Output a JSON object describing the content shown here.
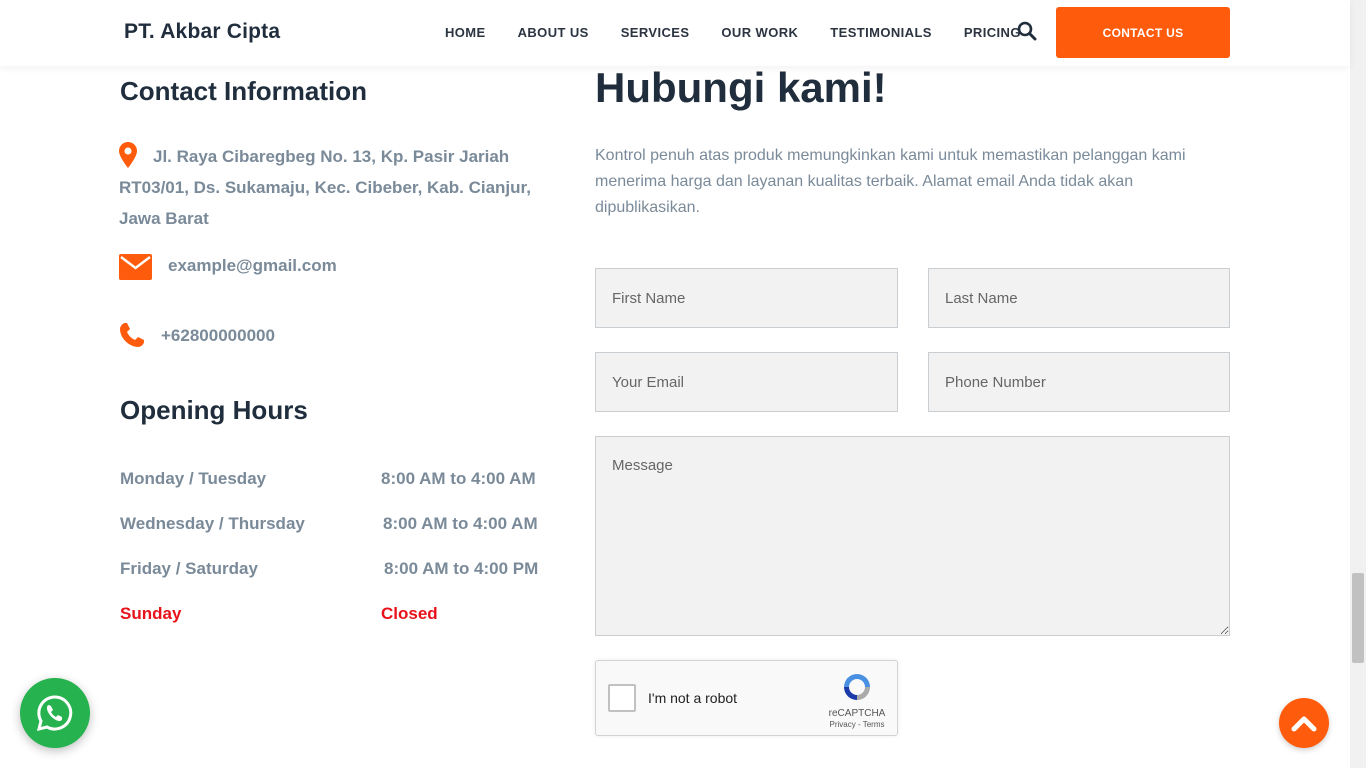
{
  "header": {
    "brand": "PT. Akbar Cipta",
    "nav": [
      "HOME",
      "ABOUT US",
      "SERVICES",
      "OUR WORK",
      "TESTIMONIALS",
      "PRICING"
    ],
    "contact_button": "CONTACT US"
  },
  "contact_info": {
    "title": "Contact Information",
    "address": "Jl. Raya Cibaregbeg No. 13, Kp. Pasir Jariah RT03/01, Ds. Sukamaju, Kec. Cibeber, Kab. Cianjur, Jawa Barat",
    "email": "example@gmail.com",
    "phone": "+62800000000"
  },
  "opening_hours": {
    "title": "Opening Hours",
    "rows": [
      {
        "day": "Monday / Tuesday",
        "time": "8:00 AM to 4:00 AM"
      },
      {
        "day": "Wednesday / Thursday",
        "time": "8:00 AM to 4:00 AM"
      },
      {
        "day": "Friday / Saturday",
        "time": "8:00 AM to 4:00 PM"
      },
      {
        "day": "Sunday",
        "time": "Closed"
      }
    ]
  },
  "form": {
    "title": "Hubungi kami!",
    "lead": "Kontrol penuh atas produk memungkinkan kami untuk memastikan pelanggan kami menerima harga dan layanan kualitas terbaik. Alamat email Anda tidak akan dipublikasikan.",
    "first_name_placeholder": "First Name",
    "last_name_placeholder": "Last Name",
    "email_placeholder": "Your Email",
    "phone_placeholder": "Phone Number",
    "message_placeholder": "Message"
  },
  "captcha": {
    "label": "I'm not a robot",
    "brand": "reCAPTCHA",
    "terms": "Privacy - Terms"
  },
  "colors": {
    "accent": "#fe5c0c",
    "closed": "#e8121b",
    "whatsapp": "#25b24f"
  }
}
